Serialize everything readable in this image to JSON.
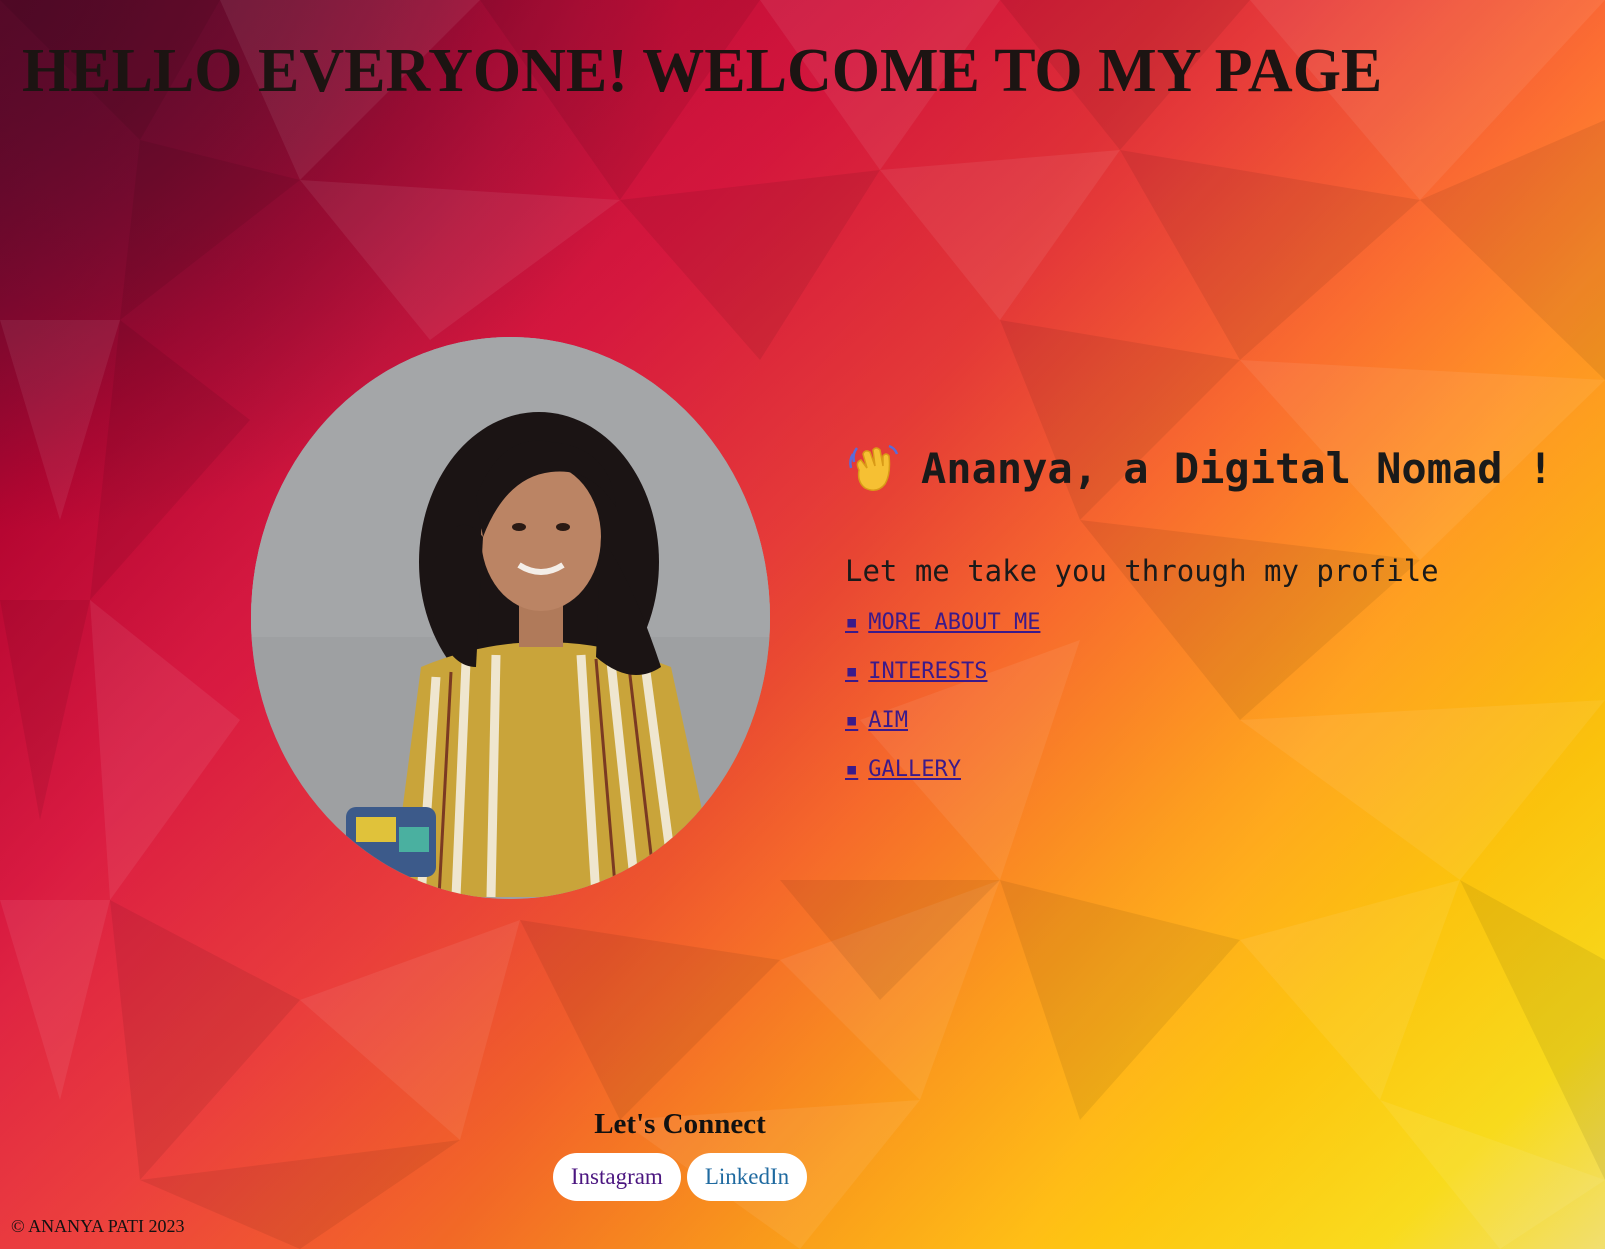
{
  "header": {
    "title": "HELLO EVERYONE! WELCOME TO MY PAGE"
  },
  "profile": {
    "photo_alt": "Ananya profile photo"
  },
  "intro": {
    "wave_icon": "waving-hand-icon",
    "greeting": "Ananya, a Digital Nomad !",
    "subtitle": "Let me take you through my profile",
    "links": [
      {
        "bullet": "▪",
        "label": "MORE ABOUT ME"
      },
      {
        "bullet": "▪",
        "label": "INTERESTS"
      },
      {
        "bullet": "▪",
        "label": "AIM"
      },
      {
        "bullet": "▪",
        "label": "GALLERY"
      }
    ]
  },
  "connect": {
    "title": "Let's Connect",
    "instagram_label": "Instagram",
    "linkedin_label": "LinkedIn"
  },
  "footer": {
    "copyright": "© ANANYA PATI 2023"
  },
  "colors": {
    "heading": "#1c1412",
    "link": "#3b1a8a",
    "instagram": "#4b1680",
    "linkedin": "#1f6aa0",
    "gradient_start": "#6a0530",
    "gradient_mid": "#f03c3a",
    "gradient_end": "#ffe01a"
  }
}
